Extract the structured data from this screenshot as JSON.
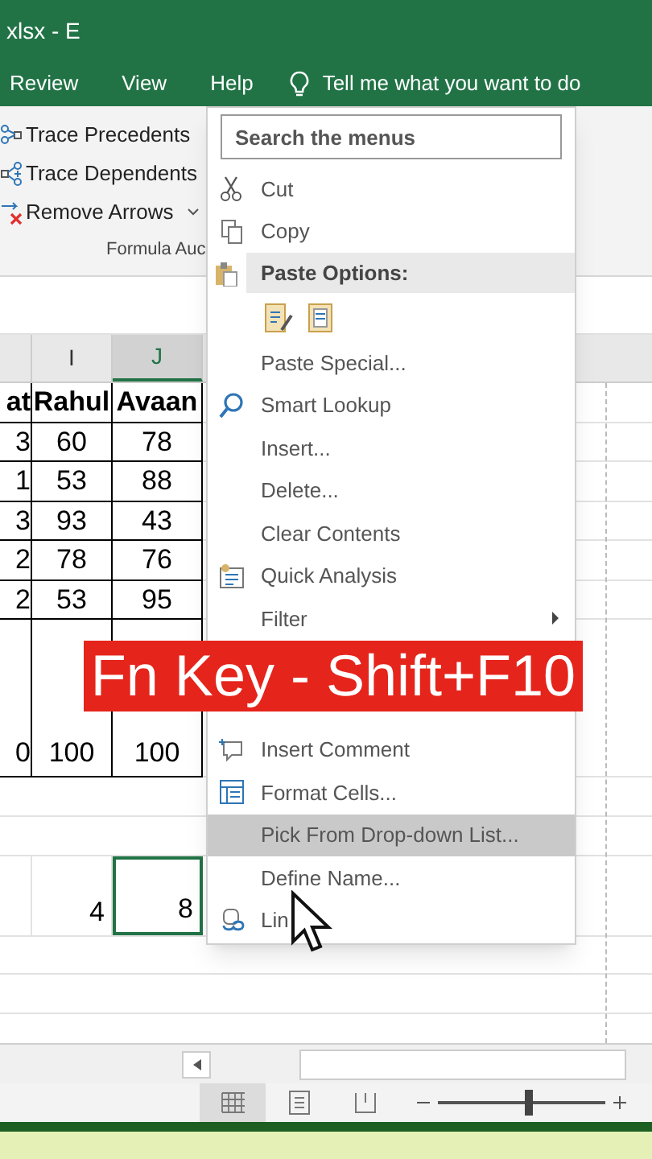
{
  "window": {
    "title": "xlsx  -  E"
  },
  "ribbon_tabs": [
    "Review",
    "View",
    "Help"
  ],
  "tell_me": {
    "placeholder": "Tell me what you want to do"
  },
  "ribbon_commands": [
    {
      "kind": "precedents",
      "label": "Trace Precedents"
    },
    {
      "kind": "dependents",
      "label": "Trace Dependents"
    },
    {
      "kind": "remove_arrows",
      "label": "Remove Arrows"
    }
  ],
  "ribbon_group": "Formula Auc",
  "sheet": {
    "columns": [
      {
        "selected": false
      },
      {
        "label": "I",
        "selected": false
      },
      {
        "label": "J",
        "selected": true
      }
    ],
    "rows": [
      {
        "kind": "header",
        "cells": [
          "at",
          "Rahul",
          "Avaan"
        ]
      },
      {
        "kind": "data",
        "cells": [
          "3",
          "60",
          "78"
        ]
      },
      {
        "kind": "data",
        "cells": [
          "1",
          "53",
          "88"
        ]
      },
      {
        "kind": "data",
        "cells": [
          "3",
          "93",
          "43"
        ]
      },
      {
        "kind": "data",
        "cells": [
          "2",
          "78",
          "76"
        ]
      },
      {
        "kind": "data",
        "cells": [
          "2",
          "53",
          "95"
        ]
      },
      {
        "kind": "total",
        "cells": [
          "0",
          "100",
          "100"
        ]
      }
    ],
    "lower_row": [
      {
        "text": "4",
        "selected": false
      },
      {
        "text": "8",
        "selected": true
      }
    ]
  },
  "context_menu": {
    "search": {
      "placeholder": "Search the menus"
    },
    "items_above": [
      {
        "kind": "cut",
        "label": "Cut",
        "selected": false,
        "submenu": false
      },
      {
        "kind": "copy",
        "label": "Copy",
        "selected": false,
        "submenu": false
      },
      {
        "kind": "paste_options",
        "label": "Paste Options:"
      },
      {
        "kind": "paste_buttons"
      },
      {
        "kind": "text",
        "label": "Paste Special...",
        "selected": false,
        "submenu": false
      },
      {
        "kind": "lookup",
        "label": "Smart Lookup",
        "selected": false,
        "submenu": false
      },
      {
        "kind": "text",
        "label": "Insert...",
        "selected": false,
        "submenu": false
      },
      {
        "kind": "text",
        "label": "Delete...",
        "selected": false,
        "submenu": false
      },
      {
        "kind": "text",
        "label": "Clear Contents",
        "selected": false,
        "submenu": false
      },
      {
        "kind": "quick_analysis",
        "label": "Quick Analysis",
        "selected": false,
        "submenu": false
      },
      {
        "kind": "text",
        "label": "Filter",
        "selected": false,
        "submenu": true
      }
    ],
    "items_below": [
      {
        "kind": "comment",
        "label": "Insert Comment",
        "selected": false,
        "submenu": false
      },
      {
        "kind": "format_cells",
        "label": "Format Cells...",
        "selected": false,
        "submenu": false
      },
      {
        "kind": "text",
        "label": "Pick From Drop-down List...",
        "selected": true,
        "submenu": false
      },
      {
        "kind": "text",
        "label": "Define Name...",
        "selected": false,
        "submenu": false
      },
      {
        "kind": "link",
        "label": "Lin",
        "selected": false,
        "submenu": false
      }
    ]
  },
  "caption_banner": {
    "text": "Fn Key - Shift+F10"
  },
  "status_bar": {
    "views": [
      {
        "kind": "normal",
        "selected": true
      },
      {
        "kind": "page_layout",
        "selected": false
      },
      {
        "kind": "page_break",
        "selected": false
      }
    ],
    "zoom_slider": {
      "level": 0.52
    }
  }
}
